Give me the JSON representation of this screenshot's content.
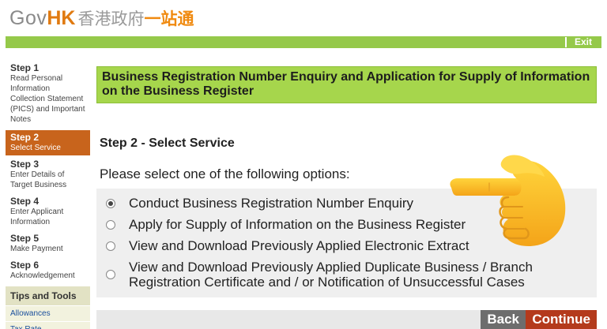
{
  "header": {
    "logo_gov": "Gov",
    "logo_hk": "HK",
    "logo_cn": "香港政府",
    "logo_cn2": "一站通",
    "exit_label": "Exit"
  },
  "sidebar": {
    "steps": [
      {
        "title": "Step 1",
        "desc": "Read Personal Information Collection Statement (PICS) and Important Notes"
      },
      {
        "title": "Step 2",
        "desc": "Select Service"
      },
      {
        "title": "Step 3",
        "desc": "Enter Details of Target Business"
      },
      {
        "title": "Step 4",
        "desc": "Enter Applicant Information"
      },
      {
        "title": "Step 5",
        "desc": "Make Payment"
      },
      {
        "title": "Step 6",
        "desc": "Acknowledgement"
      }
    ],
    "tips_title": "Tips and Tools",
    "tips_links": [
      "Allowances",
      "Tax Rate"
    ]
  },
  "main": {
    "page_title": "Business Registration Number Enquiry and Application for Supply of Information on the Business Register",
    "section_title": "Step 2 - Select Service",
    "prompt": "Please select one of the following options:",
    "options": [
      {
        "label": "Conduct Business Registration Number Enquiry",
        "checked": true
      },
      {
        "label": "Apply for Supply of Information on the Business Register",
        "checked": false
      },
      {
        "label": "View and Download Previously Applied Electronic Extract",
        "checked": false
      },
      {
        "label": "View and Download Previously Applied Duplicate Business / Branch Registration Certificate and / or Notification of Unsuccessful Cases",
        "checked": false
      }
    ],
    "back_label": "Back",
    "continue_label": "Continue"
  },
  "colors": {
    "brand_green": "#95c94a",
    "title_green": "#a6d64c",
    "active_step": "#c8641c",
    "continue_button": "#b43a1c",
    "back_button": "#6d6d6d"
  },
  "overlay": {
    "icon": "pointing-hand-emoji-icon"
  }
}
